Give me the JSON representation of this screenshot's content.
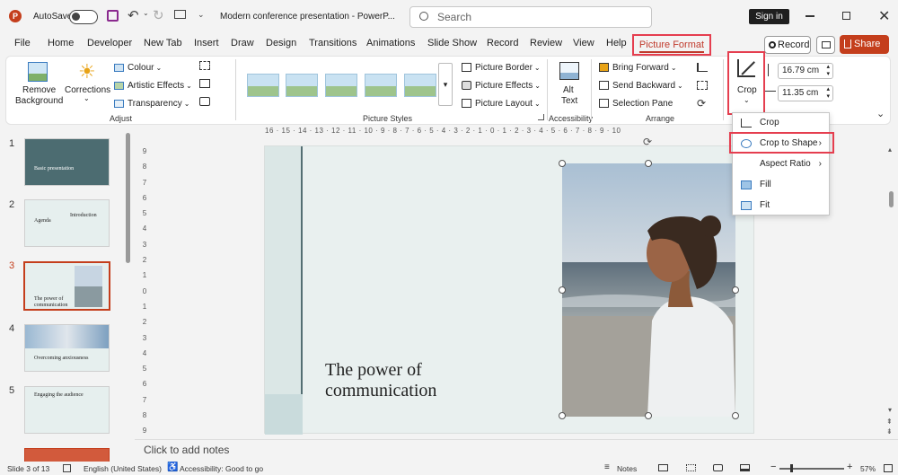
{
  "titlebar": {
    "autosave_label": "AutoSave",
    "doc_title": "Modern conference presentation  -  PowerP...",
    "search_placeholder": "Search",
    "signin_label": "Sign in"
  },
  "tabs": [
    "File",
    "Home",
    "Developer",
    "New Tab",
    "Insert",
    "Draw",
    "Design",
    "Transitions",
    "Animations",
    "Slide Show",
    "Record",
    "Review",
    "View",
    "Help"
  ],
  "active_tab": "Picture Format",
  "right_buttons": {
    "record": "Record",
    "share": "Share"
  },
  "ribbon": {
    "adjust": {
      "remove_bg": "Remove Background",
      "remove_bg_l1": "Remove",
      "remove_bg_l2": "Background",
      "corrections": "Corrections",
      "colour": "Colour",
      "artistic": "Artistic Effects",
      "transparency": "Transparency",
      "group_label": "Adjust"
    },
    "picture_styles": {
      "border": "Picture Border",
      "effects": "Picture Effects",
      "layout": "Picture Layout",
      "group_label": "Picture Styles"
    },
    "accessibility": {
      "alt_l1": "Alt",
      "alt_l2": "Text",
      "group_label": "Accessibility"
    },
    "arrange": {
      "bring_forward": "Bring Forward",
      "send_backward": "Send Backward",
      "selection_pane": "Selection Pane",
      "group_label": "Arrange"
    },
    "crop_label": "Crop",
    "height": "16.79 cm",
    "width": "11.35 cm"
  },
  "crop_menu": [
    {
      "label": "Crop"
    },
    {
      "label": "Crop to Shape",
      "has_submenu": true
    },
    {
      "label": "Aspect Ratio",
      "has_submenu": true
    },
    {
      "label": "Fill"
    },
    {
      "label": "Fit"
    }
  ],
  "thumbnails": [
    {
      "num": "1",
      "text": "Basic presentation"
    },
    {
      "num": "2",
      "text": "Agenda",
      "text2": "Introduction"
    },
    {
      "num": "3",
      "text": "The power of communication"
    },
    {
      "num": "4",
      "text": "Overcoming anxiousness"
    },
    {
      "num": "5",
      "text": "Engaging the audience"
    }
  ],
  "ruler_h": "16 · 15 · 14 · 13 · 12 · 11 · 10 · 9 · 8 · 7 · 6 · 5 · 4 · 3 · 2 · 1 · 0 · 1 · 2 · 3 · 4 · 5 · 6 · 7 · 8 · 9 · 10",
  "ruler_v": [
    "9",
    "8",
    "7",
    "6",
    "5",
    "4",
    "3",
    "2",
    "1",
    "0",
    "1",
    "2",
    "3",
    "4",
    "5",
    "6",
    "7",
    "8",
    "9"
  ],
  "slide": {
    "title_l1": "The power of",
    "title_l2": "communication"
  },
  "notes_placeholder": "Click to add notes",
  "status": {
    "slide": "Slide 3 of 13",
    "language": "English (United States)",
    "accessibility": "Accessibility: Good to go",
    "notes": "Notes",
    "zoom": "57%"
  },
  "colors": {
    "accent_red": "#c43e1c",
    "highlight": "#e53e4f",
    "active_tab_text": "#c0392b"
  }
}
